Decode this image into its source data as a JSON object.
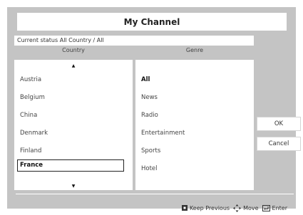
{
  "dialog": {
    "title": "My Channel"
  },
  "status": {
    "text": "Current status All Country / All"
  },
  "columns": {
    "country_header": "Country",
    "genre_header": "Genre"
  },
  "country_list": {
    "items": [
      "Austria",
      "Belgium",
      "China",
      "Denmark",
      "Finland",
      "France"
    ],
    "selected": "France",
    "scroll_up_icon": "up-arrow-icon",
    "scroll_down_icon": "down-arrow-icon"
  },
  "genre_list": {
    "items": [
      "All",
      "News",
      "Radio",
      "Entertainment",
      "Sports",
      "Hotel"
    ],
    "selected": "All"
  },
  "buttons": {
    "ok_label": "OK",
    "cancel_label": "Cancel"
  },
  "footer": {
    "keep_previous_label": "Keep Previous",
    "move_label": "Move",
    "enter_label": "Enter",
    "icons": [
      "square-key-icon",
      "dpad-arrows-icon",
      "enter-key-icon"
    ]
  },
  "colors": {
    "panel": "#c4c4c4",
    "surface": "#ffffff",
    "text": "#333333"
  }
}
